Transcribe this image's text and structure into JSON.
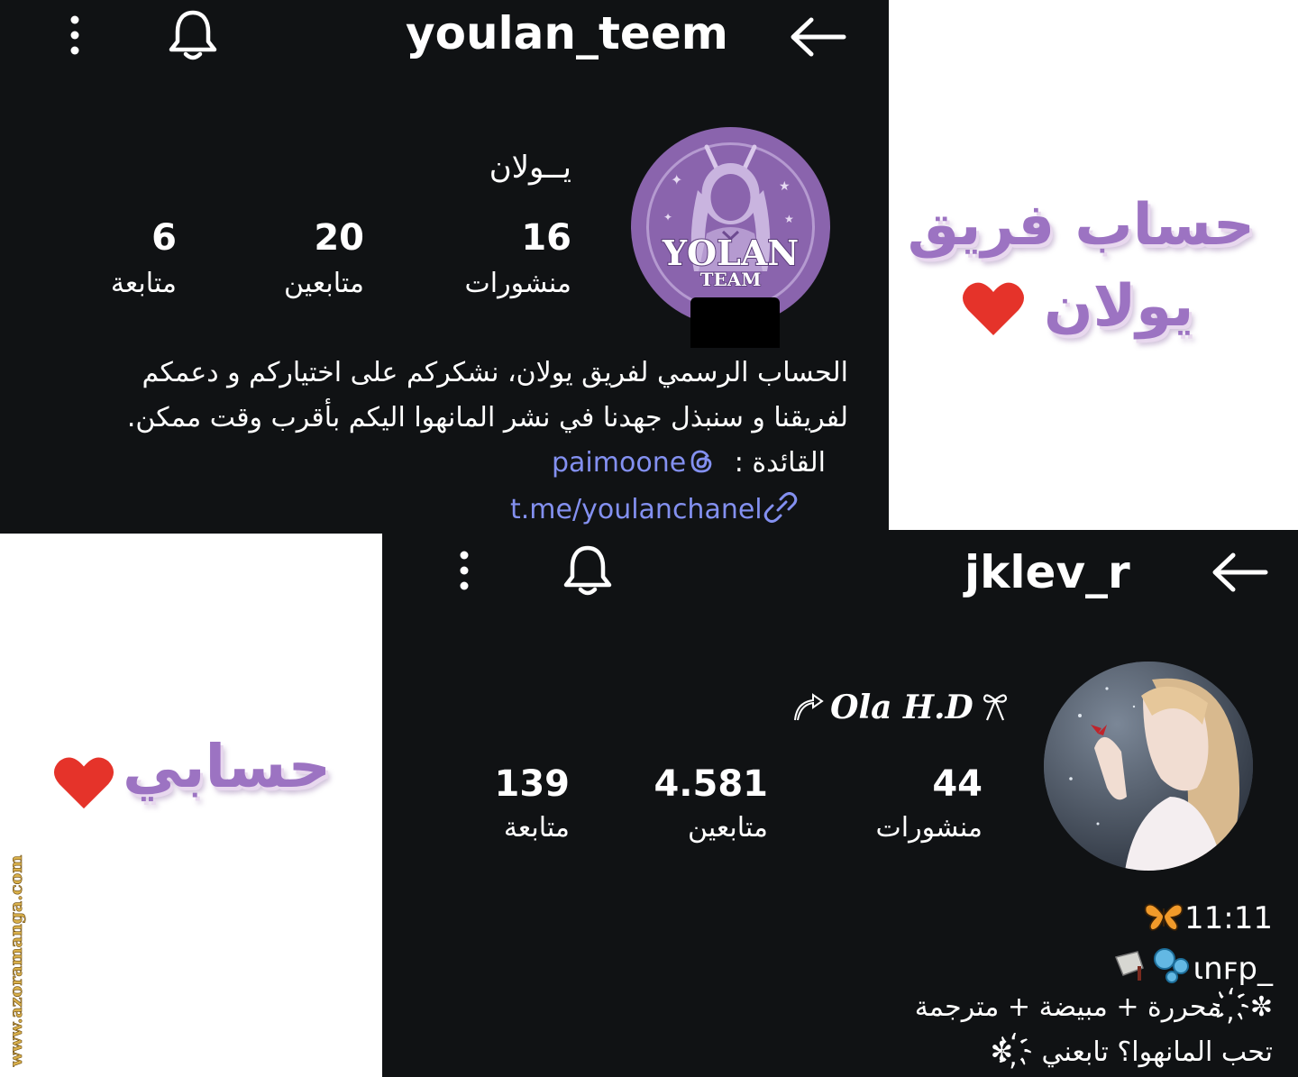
{
  "top_profile": {
    "username": "youlan_teem",
    "display_name": "يــولان",
    "stats": [
      {
        "value": "16",
        "label": "منشورات"
      },
      {
        "value": "20",
        "label": "متابعين"
      },
      {
        "value": "6",
        "label": "متابعة"
      }
    ],
    "avatar_text": {
      "line1": "YOLAN",
      "line2": "TEAM"
    },
    "bio_lines": [
      "الحساب الرسمي لفريق يولان، نشكركم على اختياركم و دعمكم",
      "لفريقنا و سنبذل جهدنا في نشر المانهوا اليكم بأقرب وقت ممكن."
    ],
    "leader_label": "القائدة :",
    "leader_handle": "paimoone",
    "link": "t.me/youlanchanel"
  },
  "top_caption": {
    "line1": "حساب فريق",
    "line2": "يولان"
  },
  "bottom_profile": {
    "username": "jklev_r",
    "display_name": "Ola H.D",
    "stats": [
      {
        "value": "44",
        "label": "منشورات"
      },
      {
        "value": "4.581",
        "label": "متابعين"
      },
      {
        "value": "139",
        "label": "متابعة"
      }
    ],
    "bio_lines": [
      "11:11",
      "ɩnꜰp_",
      "✼ ҉ محررة + مبيضة + مترجمة",
      "تحب المانهوا؟ تابعني ҉ ✼"
    ]
  },
  "bottom_caption": {
    "text": "حسابي"
  },
  "watermark": "www.azoramanga.com",
  "colors": {
    "panel_bg": "#101214",
    "link": "#8390f0",
    "caption": "#9c73c2",
    "heart": "#e5332a",
    "avatar_purple": "#8a64ad"
  },
  "icons": [
    "more-vertical-icon",
    "bell-icon",
    "back-arrow-icon",
    "threads-icon",
    "link-icon",
    "heart-icon",
    "butterfly-icon"
  ]
}
